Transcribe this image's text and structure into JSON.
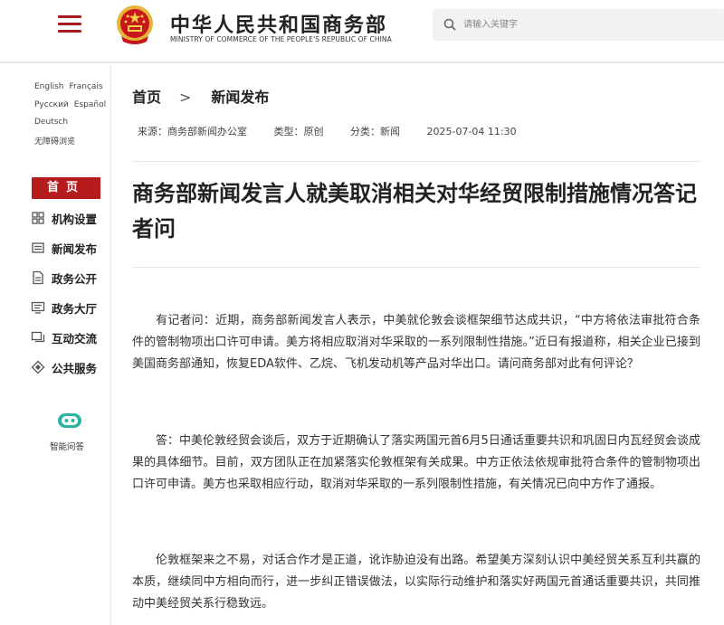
{
  "header": {
    "title_cn": "中华人民共和国商务部",
    "title_en": "MINISTRY OF COMMERCE OF THE PEOPLE'S REPUBLIC OF CHINA",
    "search_placeholder": "请输入关键字"
  },
  "sidebar": {
    "languages": [
      "English",
      "Français",
      "Русский",
      "Español",
      "Deutsch",
      "无障碍浏览"
    ],
    "home_label": "首页",
    "items": [
      {
        "label": "机构设置",
        "icon": "grid-icon"
      },
      {
        "label": "新闻发布",
        "icon": "news-icon"
      },
      {
        "label": "政务公开",
        "icon": "document-icon"
      },
      {
        "label": "政务大厅",
        "icon": "monitor-icon"
      },
      {
        "label": "互动交流",
        "icon": "chat-icon"
      },
      {
        "label": "公共服务",
        "icon": "service-icon"
      }
    ],
    "assistant_label": "智能问答"
  },
  "breadcrumb": {
    "home": "首页",
    "separator": ">",
    "current": "新闻发布"
  },
  "meta": {
    "source": "来源：商务部新闻办公室",
    "type": "类型：原创",
    "category": "分类：新闻",
    "datetime": "2025-07-04 11:30"
  },
  "article": {
    "title": "商务部新闻发言人就美取消相关对华经贸限制措施情况答记者问",
    "paragraphs": [
      "有记者问：近期，商务部新闻发言人表示，中美就伦敦会谈框架细节达成共识，“中方将依法审批符合条件的管制物项出口许可申请。美方将相应取消对华采取的一系列限制性措施。”近日有报道称，相关企业已接到美国商务部通知，恢复EDA软件、乙烷、飞机发动机等产品对华出口。请问商务部对此有何评论？",
      "答：中美伦敦经贸会谈后，双方于近期确认了落实两国元首6月5日通话重要共识和巩固日内瓦经贸会谈成果的具体细节。目前，双方团队正在加紧落实伦敦框架有关成果。中方正依法依规审批符合条件的管制物项出口许可申请。美方也采取相应行动，取消对华采取的一系列限制性措施，有关情况已向中方作了通报。",
      "伦敦框架来之不易，对话合作才是正道，讹诈胁迫没有出路。希望美方深刻认识中美经贸关系互利共赢的本质，继续同中方相向而行，进一步纠正错误做法，以实际行动维护和落实好两国元首通话重要共识，共同推动中美经贸关系行稳致远。"
    ]
  },
  "colors": {
    "brand_red": "#b71c1c",
    "emblem_gold": "#e5b53a"
  }
}
